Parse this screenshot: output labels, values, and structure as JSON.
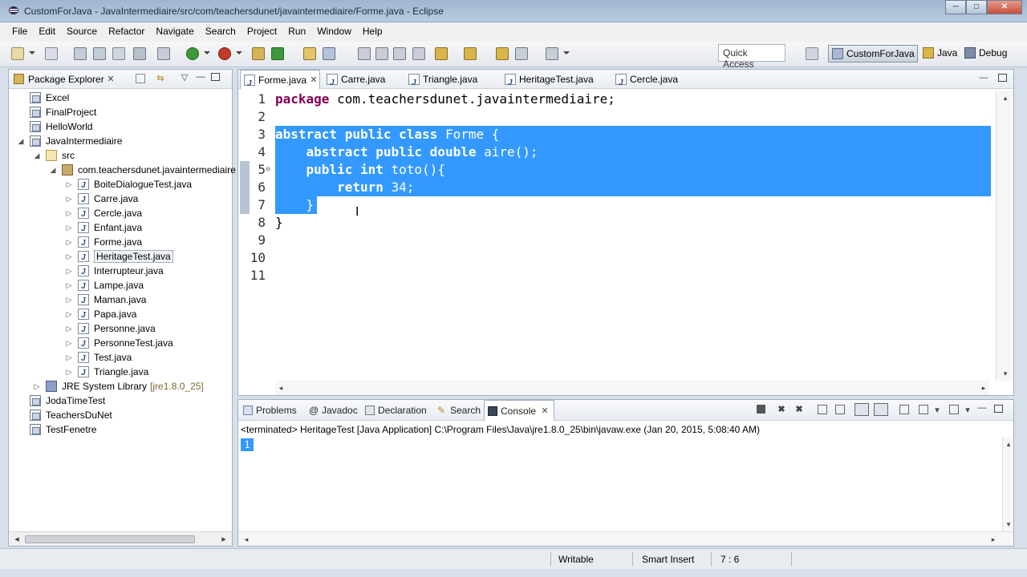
{
  "window": {
    "title": "CustomForJava - JavaIntermediaire/src/com/teachersdunet/javaintermediaire/Forme.java - Eclipse",
    "minimize": "─",
    "maximize": "□",
    "close": "✕"
  },
  "menu": [
    "File",
    "Edit",
    "Source",
    "Refactor",
    "Navigate",
    "Search",
    "Project",
    "Run",
    "Window",
    "Help"
  ],
  "toolbar": {
    "quick_access": "Quick Access",
    "perspectives": [
      "CustomForJava",
      "Java",
      "Debug"
    ]
  },
  "package_explorer": {
    "title": "Package Explorer",
    "tree": [
      {
        "label": "Excel",
        "type": "project",
        "level": 0,
        "twisty": ""
      },
      {
        "label": "FinalProject",
        "type": "project",
        "level": 0,
        "twisty": ""
      },
      {
        "label": "HelloWorld",
        "type": "project",
        "level": 0,
        "twisty": ""
      },
      {
        "label": "JavaIntermediaire",
        "type": "project",
        "level": 0,
        "twisty": "◢"
      },
      {
        "label": "src",
        "type": "src",
        "level": 1,
        "twisty": "◢"
      },
      {
        "label": "com.teachersdunet.javaintermediaire",
        "type": "pkg",
        "level": 2,
        "twisty": "◢"
      },
      {
        "label": "BoiteDialogueTest.java",
        "type": "java",
        "level": 3,
        "twisty": "▷"
      },
      {
        "label": "Carre.java",
        "type": "java",
        "level": 3,
        "twisty": "▷"
      },
      {
        "label": "Cercle.java",
        "type": "java",
        "level": 3,
        "twisty": "▷"
      },
      {
        "label": "Enfant.java",
        "type": "java",
        "level": 3,
        "twisty": "▷"
      },
      {
        "label": "Forme.java",
        "type": "java",
        "level": 3,
        "twisty": "▷"
      },
      {
        "label": "HeritageTest.java",
        "type": "java",
        "level": 3,
        "twisty": "▷",
        "selected": true
      },
      {
        "label": "Interrupteur.java",
        "type": "java",
        "level": 3,
        "twisty": "▷"
      },
      {
        "label": "Lampe.java",
        "type": "java",
        "level": 3,
        "twisty": "▷"
      },
      {
        "label": "Maman.java",
        "type": "java",
        "level": 3,
        "twisty": "▷"
      },
      {
        "label": "Papa.java",
        "type": "java",
        "level": 3,
        "twisty": "▷"
      },
      {
        "label": "Personne.java",
        "type": "java",
        "level": 3,
        "twisty": "▷"
      },
      {
        "label": "PersonneTest.java",
        "type": "java",
        "level": 3,
        "twisty": "▷"
      },
      {
        "label": "Test.java",
        "type": "java",
        "level": 3,
        "twisty": "▷"
      },
      {
        "label": "Triangle.java",
        "type": "java",
        "level": 3,
        "twisty": "▷"
      },
      {
        "label": "JRE System Library",
        "suffix": "[jre1.8.0_25]",
        "type": "lib",
        "level": 1,
        "twisty": "▷"
      },
      {
        "label": "JodaTimeTest",
        "type": "project",
        "level": 0,
        "twisty": ""
      },
      {
        "label": "TeachersDuNet",
        "type": "project",
        "level": 0,
        "twisty": ""
      },
      {
        "label": "TestFenetre",
        "type": "project",
        "level": 0,
        "twisty": ""
      }
    ]
  },
  "editor": {
    "tabs": [
      "Forme.java",
      "Carre.java",
      "Triangle.java",
      "HeritageTest.java",
      "Cercle.java"
    ],
    "active_tab": "Forme.java",
    "lines": [
      {
        "n": "1",
        "html": "<span class='kw'>package</span> com.teachersdunet.javaintermediaire;"
      },
      {
        "n": "2",
        "html": ""
      },
      {
        "n": "3",
        "html": "<span class='kw'>abstract</span> <span class='kw'>public</span> <span class='kw'>class</span> Forme {"
      },
      {
        "n": "4",
        "html": "    <span class='kw'>abstract</span> <span class='kw'>public</span> <span class='kw'>double</span> aire();"
      },
      {
        "n": "5",
        "html": "    <span class='kw'>public</span> <span class='kw'>int</span> toto(){"
      },
      {
        "n": "6",
        "html": "        <span class='kw'>return</span> 34;"
      },
      {
        "n": "7",
        "html": "    }"
      },
      {
        "n": "8",
        "html": "}"
      },
      {
        "n": "9",
        "html": ""
      },
      {
        "n": "10",
        "html": ""
      },
      {
        "n": "11",
        "html": ""
      }
    ]
  },
  "bottom_panel": {
    "tabs": [
      "Problems",
      "Javadoc",
      "Declaration",
      "Search",
      "Console"
    ],
    "active_tab": "Console",
    "header": "<terminated> HeritageTest [Java Application] C:\\Program Files\\Java\\jre1.8.0_25\\bin\\javaw.exe (Jan 20, 2015, 5:08:40 AM)",
    "output": "1"
  },
  "status": {
    "writable": "Writable",
    "insert_mode": "Smart Insert",
    "position": "7 : 6"
  },
  "colors": {
    "selection": "#3399ff",
    "keyword": "#7f0055"
  }
}
